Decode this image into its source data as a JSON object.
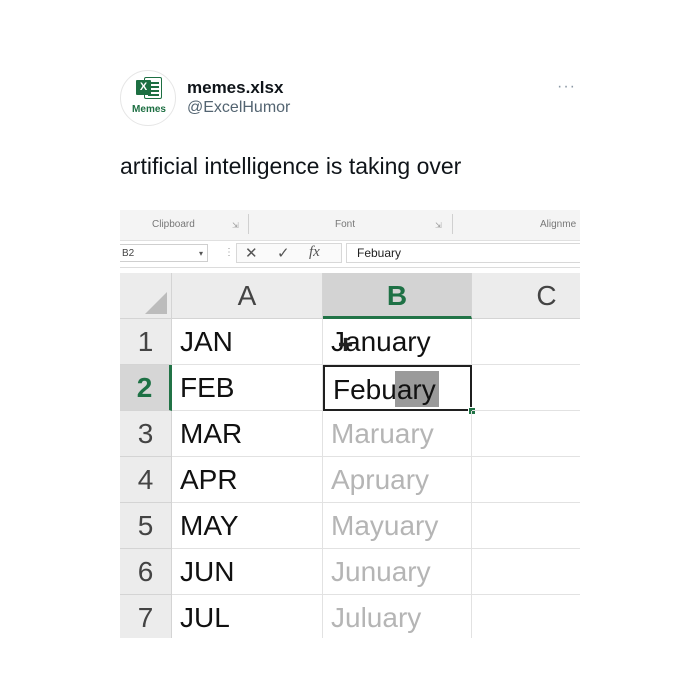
{
  "tweet": {
    "display_name": "memes.xlsx",
    "handle": "@ExcelHumor",
    "avatar_label": "Memes",
    "avatar_letter": "X",
    "more_icon": "···",
    "text": "artificial intelligence is taking over"
  },
  "excel": {
    "ribbon_groups": [
      "Clipboard",
      "Font",
      "Alignme"
    ],
    "name_box": "B2",
    "formula_icons": {
      "cancel": "✕",
      "enter": "✓",
      "function": "fx"
    },
    "formula_value": "Febuary",
    "columns": [
      "A",
      "B",
      "C"
    ],
    "selected_column": "B",
    "rows": [
      {
        "num": "1",
        "a": "JAN",
        "b": "January"
      },
      {
        "num": "2",
        "a": "FEB",
        "b": "Febuary"
      },
      {
        "num": "3",
        "a": "MAR",
        "b": "Maruary"
      },
      {
        "num": "4",
        "a": "APR",
        "b": "Apruary"
      },
      {
        "num": "5",
        "a": "MAY",
        "b": "Mayuary"
      },
      {
        "num": "6",
        "a": "JUN",
        "b": "Junuary"
      },
      {
        "num": "7",
        "a": "JUL",
        "b": "Juluary"
      }
    ],
    "active_cell": "B2",
    "ghost_rows": [
      "3",
      "4",
      "5",
      "6",
      "7"
    ]
  },
  "colors": {
    "excel_green": "#217346",
    "text": "#0f1419",
    "muted": "#536471",
    "ghost_text": "#b5b5b5"
  }
}
